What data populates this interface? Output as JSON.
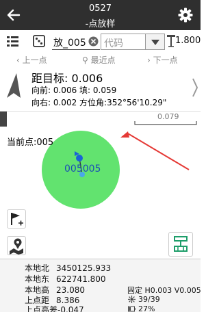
{
  "header": {
    "title_line1": "0527",
    "title_line2": "-点放样"
  },
  "toolbar": {
    "point_name": "放_005",
    "code_placeholder": "代码",
    "antenna_height": "1.800"
  },
  "point_nav": {
    "prev_label": "上一点",
    "nearest_label": "最近点",
    "next_label": "下一点"
  },
  "guidance": {
    "distance_text": "距目标: 0.006",
    "forward_text": "向前: 0.006 填: 0.059",
    "right_text": "向右: 0.002 方位角:352°56'10.29\""
  },
  "map": {
    "scale_value": "0.079",
    "current_point_label": "当前点:005",
    "target_label": "005005",
    "tolerance_color": "#62e36f",
    "position_color": "#1a63d6",
    "annotation_color": "#e53935"
  },
  "info": {
    "north_label": "本地北",
    "north_value": "3450125.933",
    "east_label": "本地东",
    "east_value": "622741.800",
    "elev_label": "本地高",
    "elev_value": "23.080",
    "prevdist_label": "上点距",
    "prevdist_value": "8.386",
    "prevdh_text": "上点高差-0.047",
    "fix_status": "固定 H0.003 V0.005",
    "satellites": "39/39",
    "battery": "27%"
  }
}
